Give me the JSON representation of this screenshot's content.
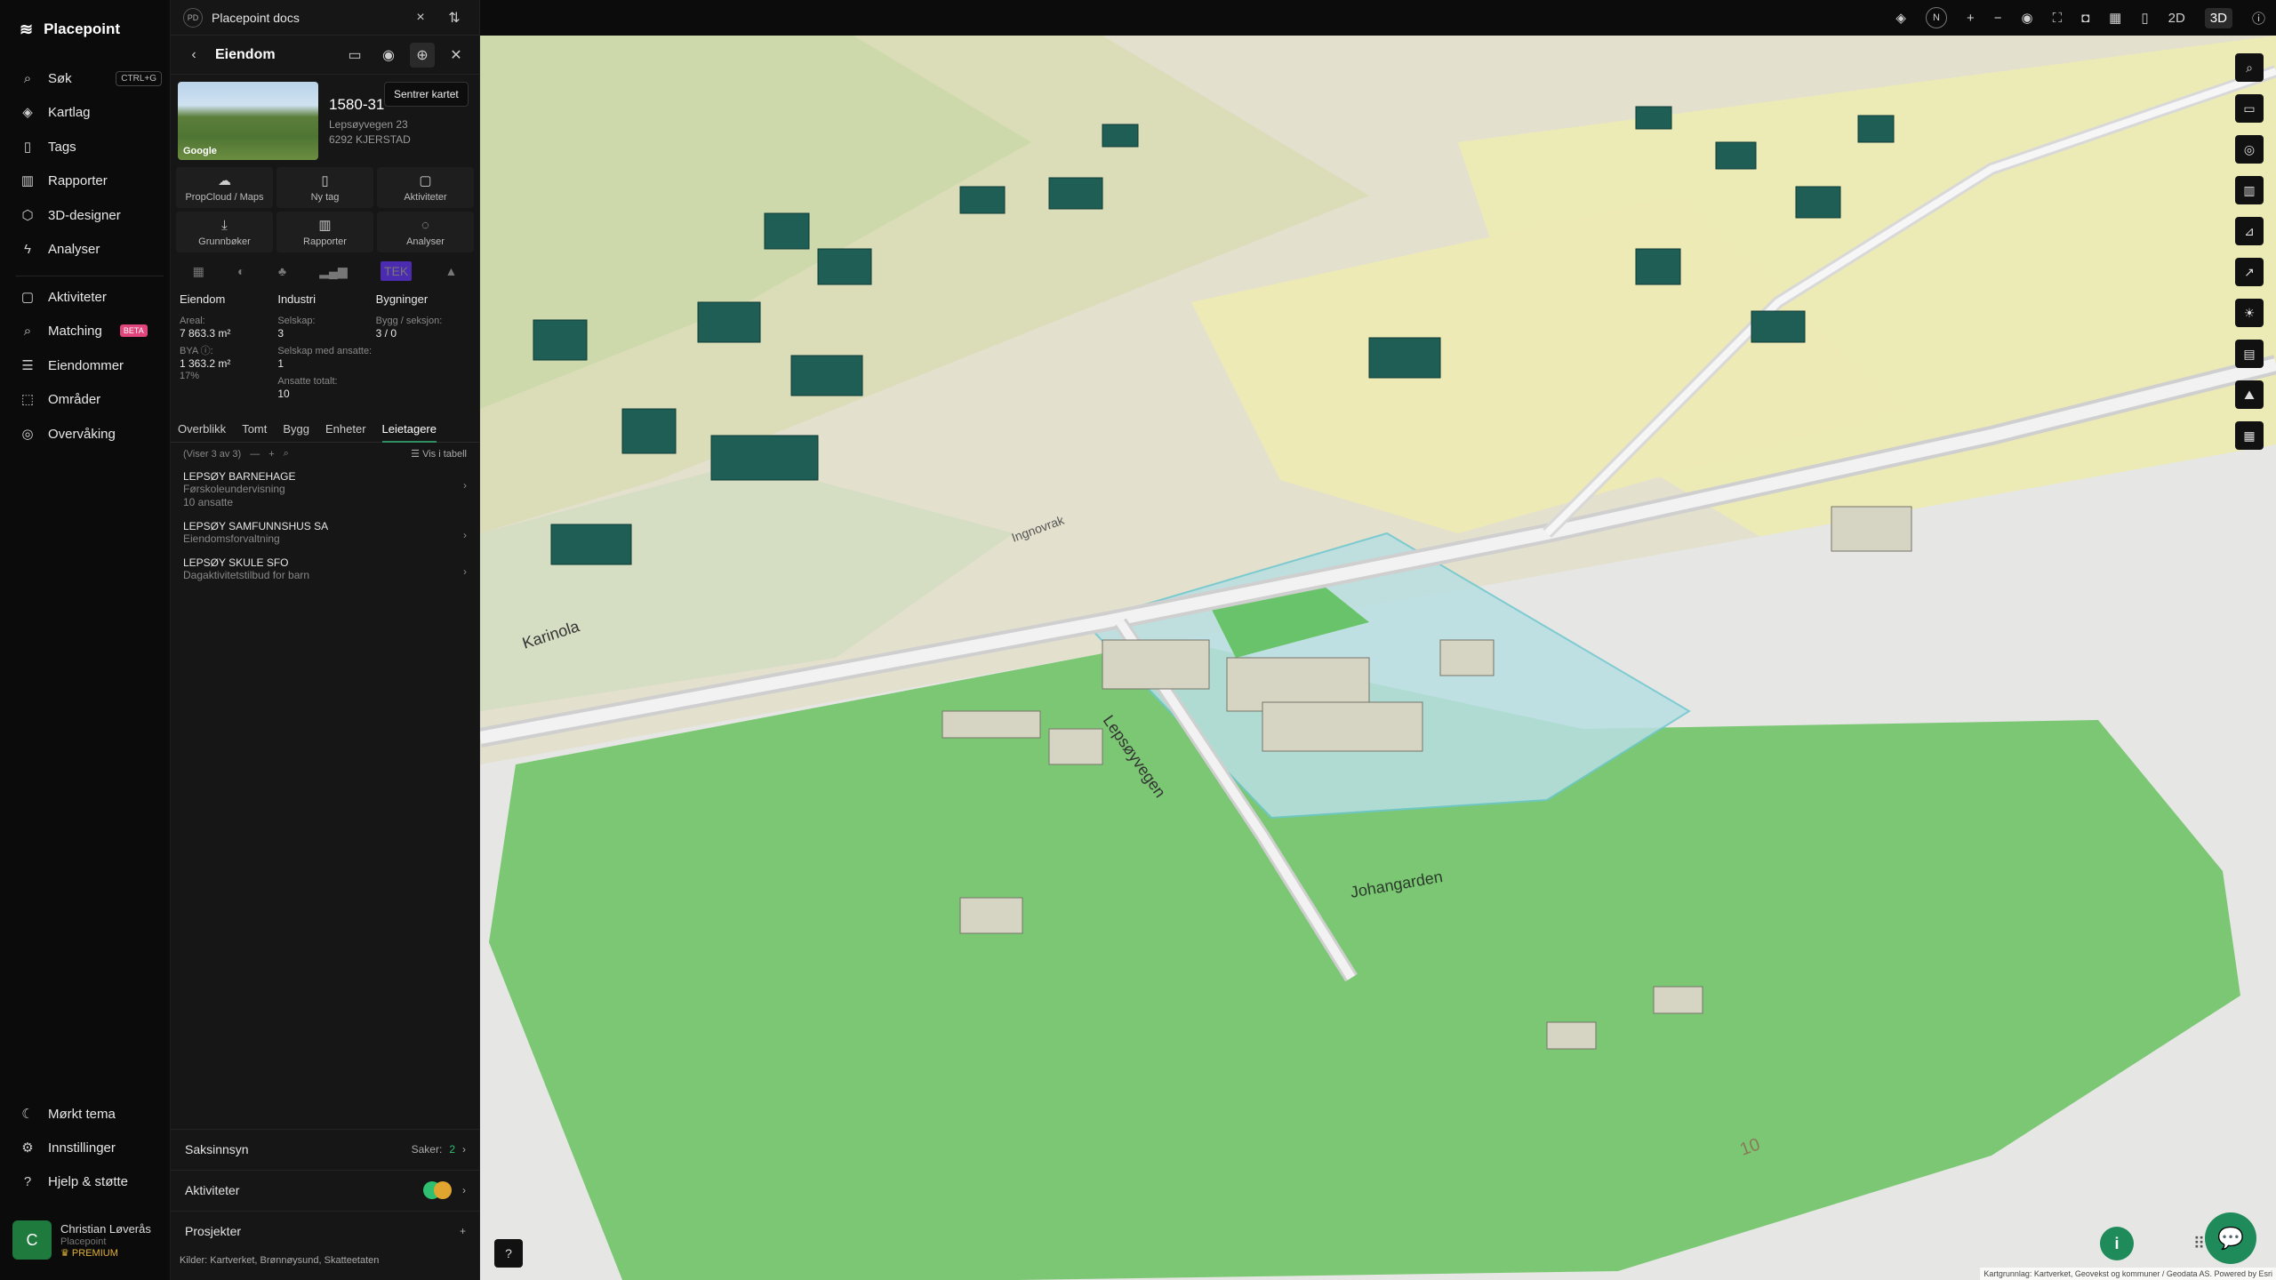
{
  "app": {
    "name": "Placepoint"
  },
  "nav": {
    "items": [
      {
        "label": "Søk",
        "kbd": "CTRL+G"
      },
      {
        "label": "Kartlag"
      },
      {
        "label": "Tags"
      },
      {
        "label": "Rapporter"
      },
      {
        "label": "3D-designer"
      },
      {
        "label": "Analyser"
      },
      {
        "label": "Aktiviteter"
      },
      {
        "label": "Matching",
        "badge": "BETA"
      },
      {
        "label": "Eiendommer"
      },
      {
        "label": "Områder"
      },
      {
        "label": "Overvåking"
      }
    ],
    "bottom": [
      {
        "label": "Mørkt tema"
      },
      {
        "label": "Innstillinger"
      },
      {
        "label": "Hjelp & støtte"
      }
    ]
  },
  "user": {
    "initial": "C",
    "name": "Christian Løverås",
    "org": "Placepoint",
    "plan": "PREMIUM"
  },
  "panel": {
    "workspace_badge": "PD",
    "workspace": "Placepoint docs",
    "title": "Eiendom",
    "tooltip": "Sentrer kartet",
    "thumb_label": "Google",
    "property_id": "1580-31",
    "address1": "Lepsøyvegen 23",
    "address2": "6292 KJERSTAD",
    "actions": [
      "PropCloud / Maps",
      "Ny tag",
      "Aktiviteter",
      "Grunnbøker",
      "Rapporter",
      "Analyser"
    ],
    "tek": "TEK",
    "stats": {
      "c1": {
        "h": "Eiendom",
        "l1": "Areal:",
        "v1": "7 863.3 m²",
        "l2": "BYA ⓘ:",
        "v2": "1 363.2 m²",
        "l3": "17%"
      },
      "c2": {
        "h": "Industri",
        "l1": "Selskap:",
        "v1": "3",
        "l2": "Selskap med ansatte:",
        "v2": "1",
        "l3": "Ansatte totalt:",
        "v3": "10"
      },
      "c3": {
        "h": "Bygninger",
        "l1": "Bygg / seksjon:",
        "v1": "3 / 0"
      }
    },
    "tabs": [
      "Overblikk",
      "Tomt",
      "Bygg",
      "Enheter",
      "Leietagere"
    ],
    "list_count": "(Viser 3 av 3)",
    "view_table": "Vis i tabell",
    "tenants": [
      {
        "name": "LEPSØY BARNEHAGE",
        "sub1": "Førskoleundervisning",
        "sub2": "10 ansatte"
      },
      {
        "name": "LEPSØY SAMFUNNSHUS SA",
        "sub1": "Eiendomsforvaltning",
        "sub2": ""
      },
      {
        "name": "LEPSØY SKULE SFO",
        "sub1": "Dagaktivitetstilbud for barn",
        "sub2": ""
      }
    ],
    "sections": {
      "saksinnsyn": "Saksinnsyn",
      "saker_label": "Saker:",
      "saker_count": "2",
      "aktiviteter": "Aktiviteter",
      "prosjekter": "Prosjekter"
    },
    "sources": {
      "label": "Kilder:",
      "list": "Kartverket, Brønnøysund, Skatteetaten"
    }
  },
  "mapbar": {
    "north": "N",
    "mode2d": "2D",
    "mode3d": "3D"
  },
  "map": {
    "labels": {
      "road1": "Lepsøyvegen",
      "road2": "Karinola",
      "farm": "Johangarden",
      "contour": "10",
      "road3": "Ingnovrak"
    },
    "attribution": "Kartgrunnlag: Kartverket, Geovekst og kommuner / Geodata AS. Powered by Esri"
  },
  "colors": {
    "accent": "#1f8a5a",
    "building": "#1e5e55",
    "parcel": "#7fcf7f"
  }
}
